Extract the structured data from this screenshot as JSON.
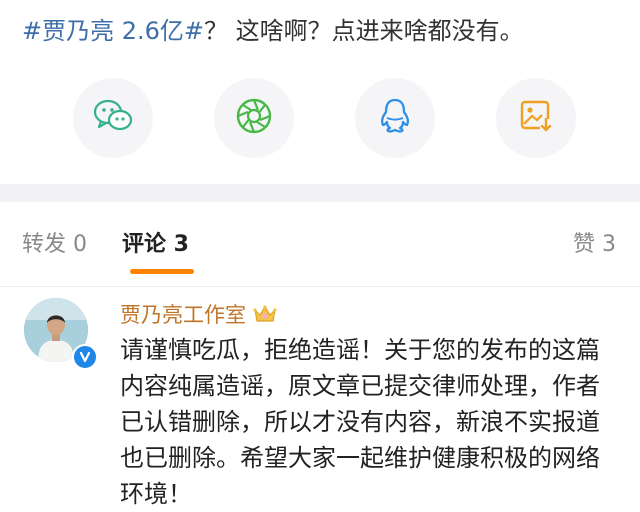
{
  "post": {
    "hashtag": "#贾乃亮 2.6亿#",
    "text": "？ 这啥啊？点进来啥都没有。"
  },
  "share_buttons": [
    {
      "icon": "wechat-icon"
    },
    {
      "icon": "moments-icon"
    },
    {
      "icon": "qq-icon"
    },
    {
      "icon": "save-image-icon"
    }
  ],
  "tabs": {
    "repost": "转发 0",
    "comments": "评论 3",
    "likes": "赞 3"
  },
  "comment": {
    "author": "贾乃亮工作室",
    "lines": [
      "请谨慎吃瓜，拒绝造谣！关于您的发布的这篇",
      "内容纯属造谣，原文章已提交律师处理，作者",
      "已认错删除，所以才没有内容，新浪不实报道",
      "也已删除。希望大家一起维护健康积极的网络",
      "环境！"
    ]
  },
  "colors": {
    "hashtag": "#3e6ea8",
    "author": "#c0742a",
    "accent": "#ff8200",
    "verified": "#1f87e8"
  }
}
